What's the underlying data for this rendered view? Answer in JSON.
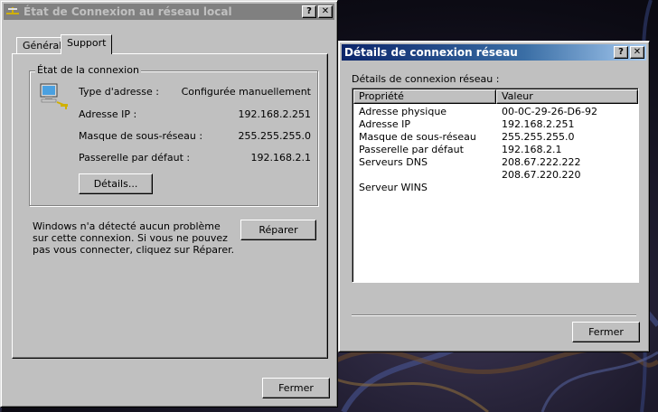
{
  "win1": {
    "title": "État de Connexion au réseau local",
    "help_btn": "?",
    "close_btn": "✕",
    "tabs": [
      {
        "label": "Général"
      },
      {
        "label": "Support"
      }
    ],
    "group_title": "État de la connexion",
    "rows": [
      {
        "label": "Type d'adresse :",
        "value": "Configurée manuellement"
      },
      {
        "label": "Adresse IP :",
        "value": "192.168.2.251"
      },
      {
        "label": "Masque de sous-réseau :",
        "value": "255.255.255.0"
      },
      {
        "label": "Passerelle par défaut :",
        "value": "192.168.2.1"
      }
    ],
    "details_button": "Détails...",
    "message": "Windows n'a détecté aucun problème sur cette connexion. Si vous ne pouvez pas vous connecter, cliquez sur Réparer.",
    "repair_button": "Réparer",
    "close_button": "Fermer"
  },
  "win2": {
    "title": "Détails de connexion réseau",
    "help_btn": "?",
    "close_btn": "✕",
    "list_label": "Détails de connexion réseau :",
    "columns": [
      "Propriété",
      "Valeur"
    ],
    "rows": [
      {
        "prop": "Adresse physique",
        "value": "00-0C-29-26-D6-92"
      },
      {
        "prop": "Adresse IP",
        "value": "192.168.2.251"
      },
      {
        "prop": "Masque de sous-réseau",
        "value": "255.255.255.0"
      },
      {
        "prop": "Passerelle par défaut",
        "value": "192.168.2.1"
      },
      {
        "prop": "Serveurs DNS",
        "value": "208.67.222.222"
      },
      {
        "prop": "",
        "value": "208.67.220.220"
      },
      {
        "prop": "Serveur WINS",
        "value": ""
      }
    ],
    "close_button": "Fermer"
  }
}
